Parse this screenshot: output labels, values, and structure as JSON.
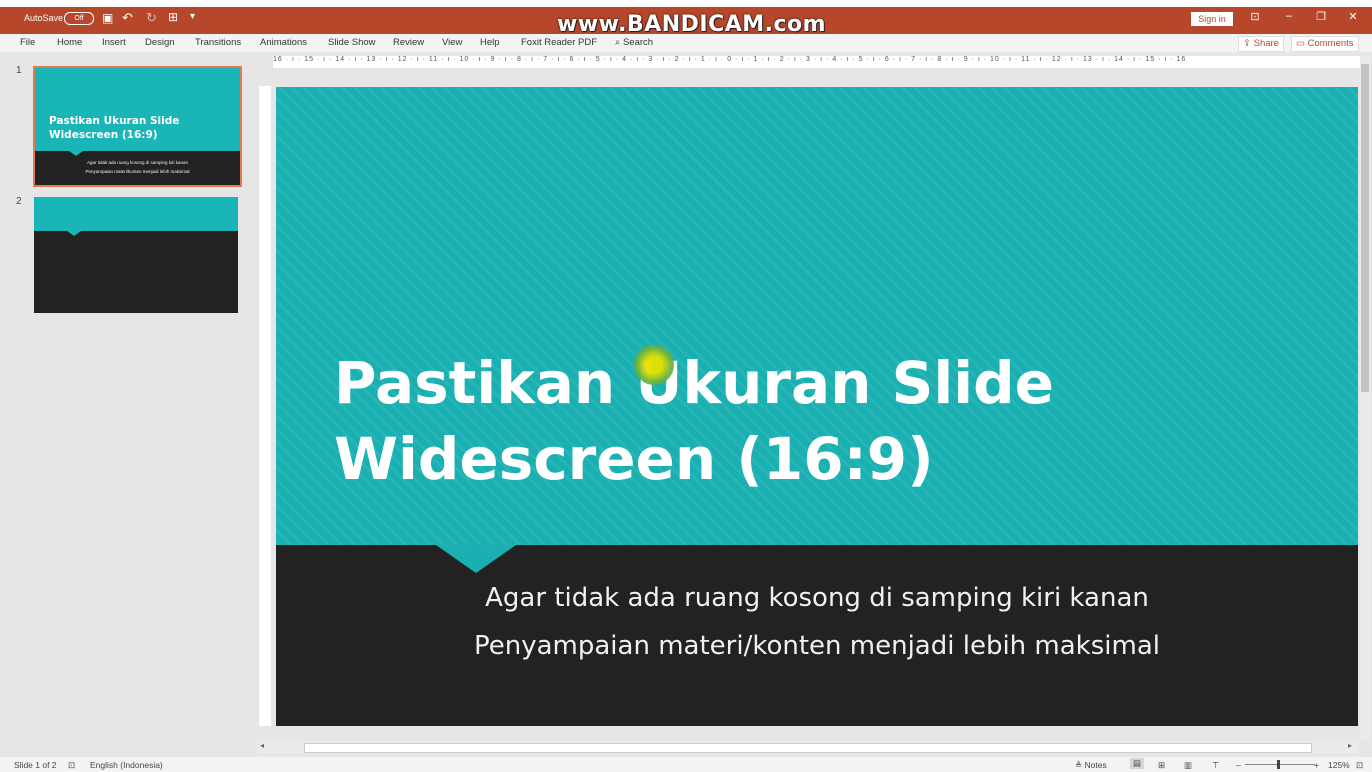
{
  "titlebar": {
    "autosave_label": "AutoSave",
    "autosave_state": "Off",
    "watermark": "www.BANDICAM.com",
    "signin": "Sign in"
  },
  "menu": [
    "File",
    "Home",
    "Insert",
    "Design",
    "Transitions",
    "Animations",
    "Slide Show",
    "Review",
    "View",
    "Help",
    "Foxit Reader PDF"
  ],
  "search_label": "Search",
  "share_label": "Share",
  "comments_label": "Comments",
  "ruler_text": "16 · ı · 15 · ı · 14 · ı · 13 · ı · 12 · ı · 11 · ı · 10 · ı · 9 · ı · 8 · ı · 7 · ı · 6 · ı · 5 · ı · 4 · ı · 3 · ı · 2 · ı · 1 · ı · 0 · ı · 1 · ı · 2 · ı · 3 · ı · 4 · ı · 5 · ı · 6 · ı · 7 · ı · 8 · ı · 9 · ı · 10 · ı · 11 · ı · 12 · ı · 13 · ı · 14 · ı · 15 · ı · 16",
  "slides": [
    {
      "number": "1",
      "title_line1": "Pastikan Ukuran Slide",
      "title_line2": "Widescreen (16:9)",
      "sub1": "Agar tidak ada ruang kosong di samping kiri kanan",
      "sub2": "Penyampaian materi/konten menjadi lebih maksimal"
    },
    {
      "number": "2"
    }
  ],
  "main_slide": {
    "title_line1": "Pastikan Ukuran Slide",
    "title_line2": "Widescreen (16:9)",
    "subtitle_line1": "Agar tidak ada ruang kosong di samping kiri kanan",
    "subtitle_line2": "Penyampaian materi/konten menjadi lebih maksimal"
  },
  "status": {
    "slide_count": "Slide 1 of 2",
    "language": "English (Indonesia)",
    "notes": "Notes",
    "zoom": "125%"
  },
  "colors": {
    "accent": "#b7472a",
    "slide_teal": "#1ab0b2",
    "slide_dark": "#222222",
    "selected_border": "#e07a52"
  }
}
